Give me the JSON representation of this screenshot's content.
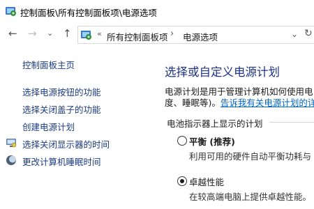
{
  "window": {
    "title": "控制面板\\所有控制面板项\\电源选项"
  },
  "nav": {
    "back_icon": "arrow-left-icon",
    "forward_icon": "arrow-right-icon",
    "dropdown_icon": "chevron-down-icon",
    "up_icon": "arrow-up-icon"
  },
  "address": {
    "sep1": "«",
    "crumb1": "所有控制面板项",
    "sep2": "›",
    "crumb2": "电源选项",
    "dropdown": "⌄",
    "refresh": "↻"
  },
  "sidebar": {
    "home": "控制面板主页",
    "items": [
      {
        "label": "选择电源按钮的功能",
        "icon": ""
      },
      {
        "label": "选择关闭盖子的功能",
        "icon": ""
      },
      {
        "label": "创建电源计划",
        "icon": ""
      },
      {
        "label": "选择关闭显示器的时间",
        "icon": "monitor-icon"
      },
      {
        "label": "更改计算机睡眠时间",
        "icon": "sleep-moon-icon"
      }
    ]
  },
  "main": {
    "title": "选择或自定义电源计划",
    "desc_line1": "电源计划是用于管理计算机如何使用电",
    "desc_line2_prefix": "度、睡眠等)。",
    "desc_link": "告诉我有关电源计划的详",
    "group_label": "电池指示器上显示的计划",
    "plans": [
      {
        "name": "平衡 (推荐)",
        "bold": true,
        "selected": false,
        "description": "利用可用的硬件自动平衡功耗与"
      },
      {
        "name": "卓越性能",
        "bold": false,
        "selected": true,
        "description": "在较高端电脑上提供卓越性能。"
      }
    ]
  }
}
